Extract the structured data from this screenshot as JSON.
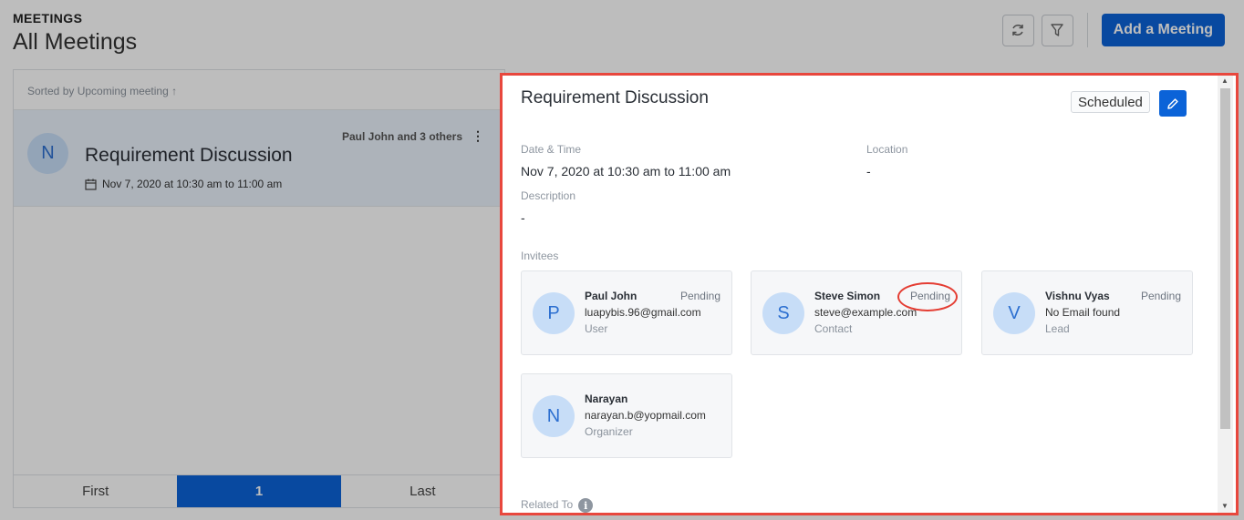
{
  "header": {
    "eyebrow": "MEETINGS",
    "title": "All Meetings",
    "add_button": "Add a Meeting"
  },
  "list": {
    "sort_prefix": "Sorted by",
    "sort_field": "Upcoming meeting",
    "sort_arrow": "↑",
    "items": [
      {
        "avatar": "N",
        "title": "Requirement Discussion",
        "datetime": "Nov 7, 2020 at 10:30 am to 11:00 am",
        "people": "Paul John and 3 others"
      }
    ],
    "pager": {
      "first": "First",
      "current": "1",
      "last": "Last"
    }
  },
  "detail": {
    "title": "Requirement Discussion",
    "status": "Scheduled",
    "date_label": "Date & Time",
    "date_value": "Nov 7, 2020 at 10:30 am to 11:00 am",
    "location_label": "Location",
    "location_value": "-",
    "description_label": "Description",
    "description_value": "-",
    "invitees_label": "Invitees",
    "invitees": [
      {
        "avatar": "P",
        "name": "Paul John",
        "email": "luapybis.96@gmail.com",
        "role": "User",
        "status": "Pending"
      },
      {
        "avatar": "S",
        "name": "Steve Simon",
        "email": "steve@example.com",
        "role": "Contact",
        "status": "Pending"
      },
      {
        "avatar": "V",
        "name": "Vishnu Vyas",
        "email": "No Email found",
        "role": "Lead",
        "status": "Pending"
      },
      {
        "avatar": "N",
        "name": "Narayan",
        "email": "narayan.b@yopmail.com",
        "role": "Organizer",
        "status": ""
      }
    ],
    "related_label": "Related To"
  },
  "colors": {
    "accent": "#0b63d8",
    "highlight": "#e8473d",
    "avatar_bg": "#c7ddf7"
  }
}
